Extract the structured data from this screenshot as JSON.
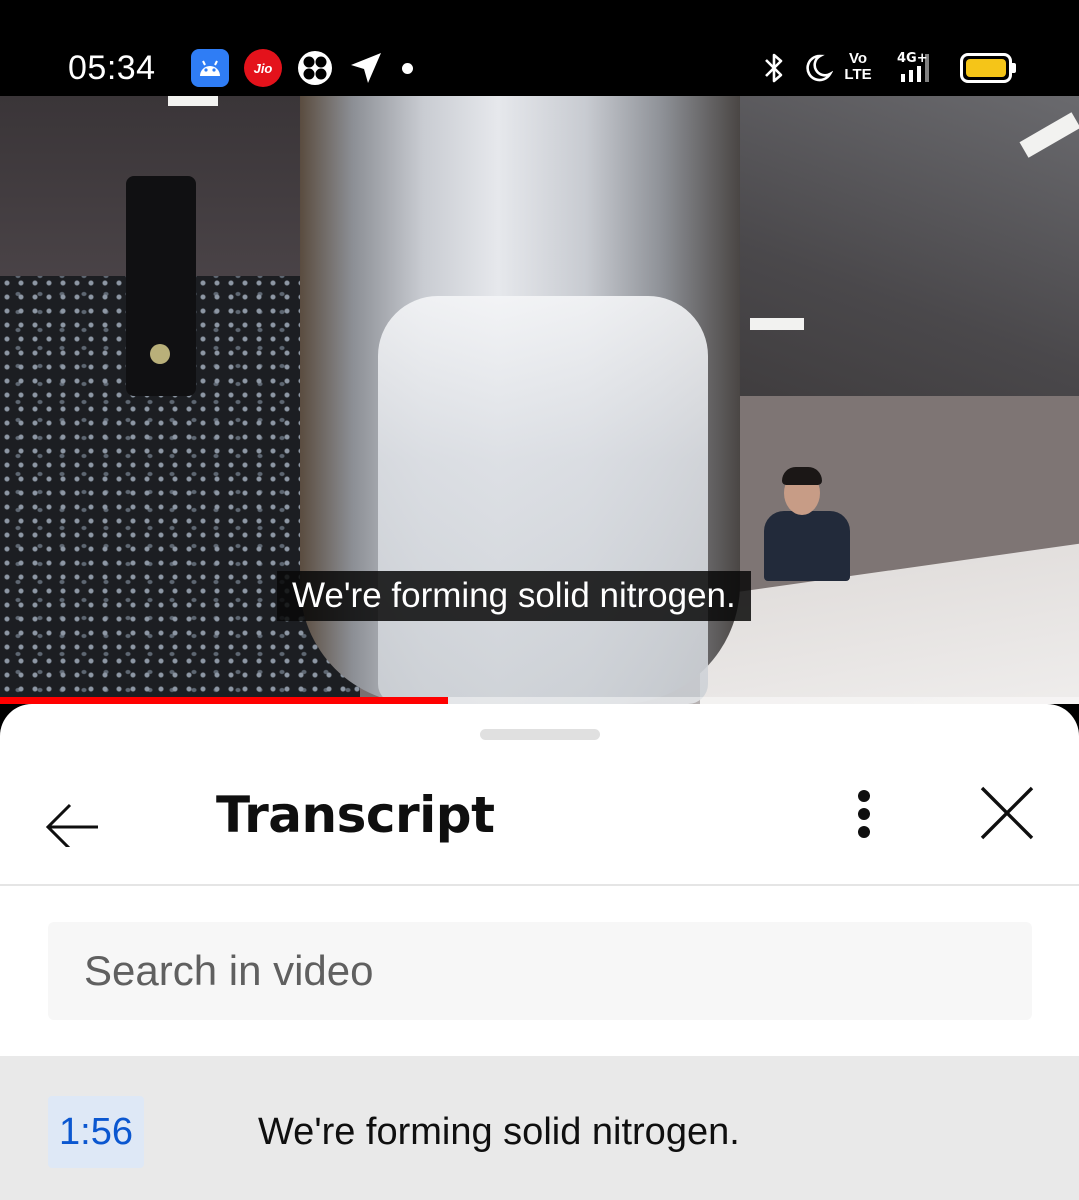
{
  "status_bar": {
    "time": "05:34",
    "jio_label": "Jio",
    "network_volte_top": "Vo",
    "network_volte_bottom": "LTE",
    "network_type": "4G+",
    "icons": [
      "android-icon",
      "jio-icon",
      "fan-icon",
      "navigation-arrow-icon",
      "dot-icon",
      "bluetooth-icon",
      "moon-icon",
      "volte-icon",
      "signal-icon",
      "battery-icon"
    ],
    "battery_color": "#f5c518"
  },
  "video": {
    "caption": "We're forming solid nitrogen.",
    "progress_fraction": 0.415,
    "progress_color": "#ff0000"
  },
  "sheet": {
    "title": "Transcript",
    "back_icon": "arrow-left-icon",
    "menu_icon": "more-vertical-icon",
    "close_icon": "close-icon",
    "search": {
      "placeholder": "Search in video",
      "value": ""
    },
    "segments": [
      {
        "timestamp": "1:56",
        "text": "We're forming solid nitrogen."
      }
    ],
    "timestamp_color": "#0b57d0"
  }
}
